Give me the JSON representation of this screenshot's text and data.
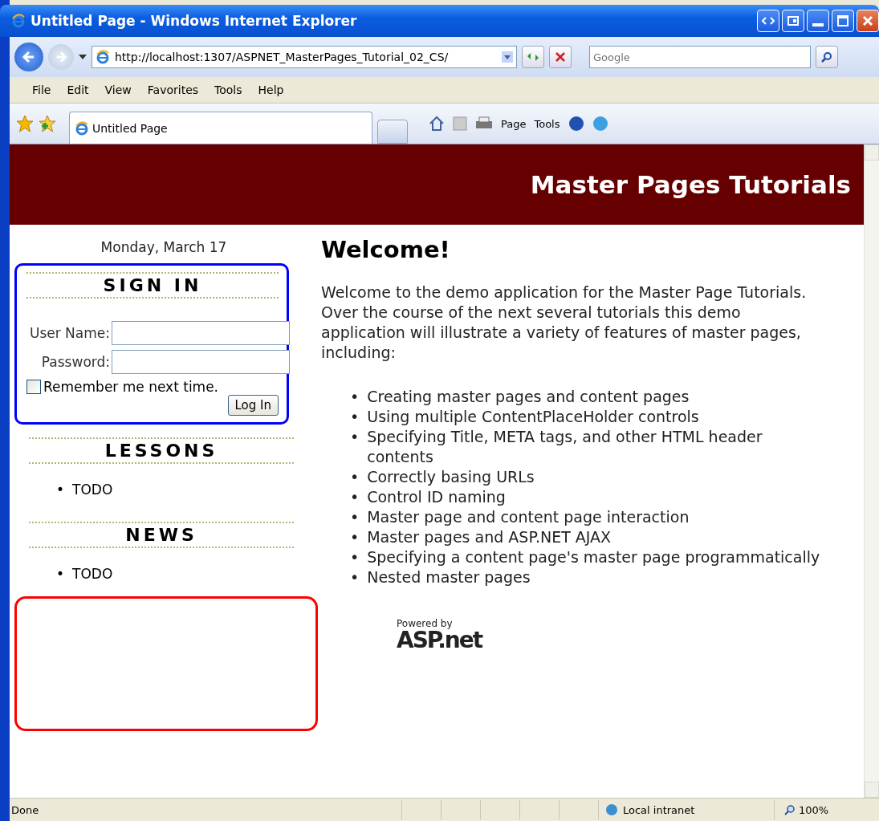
{
  "window": {
    "title": "Untitled Page - Windows Internet Explorer",
    "buttons": [
      {
        "kind": "restore-left"
      },
      {
        "kind": "restore-tab"
      },
      {
        "kind": "minimize"
      },
      {
        "kind": "maximize"
      },
      {
        "kind": "close"
      }
    ]
  },
  "address_bar": {
    "url": "http://localhost:1307/ASPNET_MasterPages_Tutorial_02_CS/",
    "search_placeholder": "Google"
  },
  "menu": [
    "File",
    "Edit",
    "View",
    "Favorites",
    "Tools",
    "Help"
  ],
  "tabs": [
    {
      "label": "Untitled Page",
      "selected": true
    }
  ],
  "command_bar": [
    "Page",
    "Tools"
  ],
  "page": {
    "header_title": "Master Pages Tutorials",
    "date": "Monday, March 17",
    "login": {
      "title": "SIGN IN",
      "user_label": "User Name:",
      "password_label": "Password:",
      "remember": {
        "label": "Remember me next time.",
        "checked": false
      },
      "button": "Log In"
    },
    "sections": [
      {
        "title": "LESSONS",
        "items": [
          "TODO"
        ]
      },
      {
        "title": "NEWS",
        "items": [
          "TODO"
        ]
      }
    ],
    "heading": "Welcome!",
    "intro": "Welcome to the demo application for the Master Page Tutorials. Over the course of the next several tutorials this demo application will illustrate a variety of features of master pages, including:",
    "features": [
      " Creating master pages and content pages",
      "Using multiple ContentPlaceHolder controls",
      "Specifying Title, META tags, and other HTML header contents",
      "Correctly basing URLs",
      "Control ID naming",
      "Master page and content page interaction",
      "Master pages and ASP.NET AJAX",
      "Specifying a content page's master page programmatically",
      "Nested master pages"
    ],
    "bullet": "•",
    "powered_by": "Powered by",
    "logo": "ASP.net"
  },
  "status_bar": {
    "text": "Done",
    "zone": "Local intranet",
    "zoom": "100%"
  }
}
